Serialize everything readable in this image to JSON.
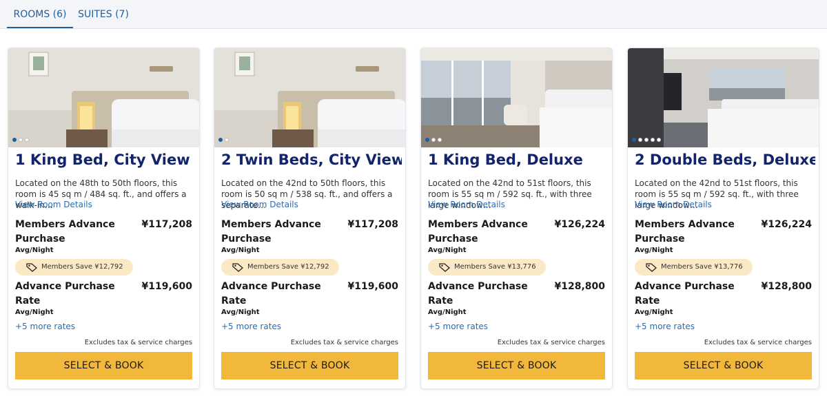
{
  "tabs": [
    {
      "label": "ROOMS (6)",
      "active": true
    },
    {
      "label": "SUITES (7)",
      "active": false
    }
  ],
  "colors": {
    "accent_blue": "#1f5fa0",
    "title_navy": "#13246b",
    "button_gold": "#f2b83c",
    "badge_bg": "#fbe9c6"
  },
  "cards": [
    {
      "title": "1 King Bed, City View",
      "description": "Located on the 48th to 50th floors, this room is 45 sq m / 484 sq. ft., and offers a walk-in…",
      "details_link": "View Room Details",
      "image_dots": 3,
      "rates": [
        {
          "name": "Members Advance Purchase",
          "price": "¥117,208",
          "unit": "Avg/Night",
          "badge": "Members Save ¥12,792"
        },
        {
          "name": "Advance Purchase Rate",
          "price": "¥119,600",
          "unit": "Avg/Night"
        }
      ],
      "more_rates": "+5 more rates",
      "excludes": "Excludes tax & service charges",
      "button": "SELECT & BOOK"
    },
    {
      "title": "2 Twin Beds, City View",
      "description": "Located on the 42nd to 50th floors, this room is 50 sq m / 538 sq. ft., and offers a separate…",
      "details_link": "View Room Details",
      "image_dots": 2,
      "rates": [
        {
          "name": "Members Advance Purchase",
          "price": "¥117,208",
          "unit": "Avg/Night",
          "badge": "Members Save ¥12,792"
        },
        {
          "name": "Advance Purchase Rate",
          "price": "¥119,600",
          "unit": "Avg/Night"
        }
      ],
      "more_rates": "+5 more rates",
      "excludes": "Excludes tax & service charges",
      "button": "SELECT & BOOK"
    },
    {
      "title": "1 King Bed, Deluxe",
      "description": "Located on the 42nd to 51st floors, this room is 55 sq m / 592 sq. ft., with three large window…",
      "details_link": "View Room Details",
      "image_dots": 3,
      "rates": [
        {
          "name": "Members Advance Purchase",
          "price": "¥126,224",
          "unit": "Avg/Night",
          "badge": "Members Save ¥13,776"
        },
        {
          "name": "Advance Purchase Rate",
          "price": "¥128,800",
          "unit": "Avg/Night"
        }
      ],
      "more_rates": "+5 more rates",
      "excludes": "Excludes tax & service charges",
      "button": "SELECT & BOOK"
    },
    {
      "title": "2 Double Beds, Deluxe",
      "description": "Located on the 42nd to 51st floors, this room is 55 sq m / 592 sq. ft., with three large window…",
      "details_link": "View Room Details",
      "image_dots": 5,
      "rates": [
        {
          "name": "Members Advance Purchase",
          "price": "¥126,224",
          "unit": "Avg/Night",
          "badge": "Members Save ¥13,776"
        },
        {
          "name": "Advance Purchase Rate",
          "price": "¥128,800",
          "unit": "Avg/Night"
        }
      ],
      "more_rates": "+5 more rates",
      "excludes": "Excludes tax & service charges",
      "button": "SELECT & BOOK"
    }
  ]
}
